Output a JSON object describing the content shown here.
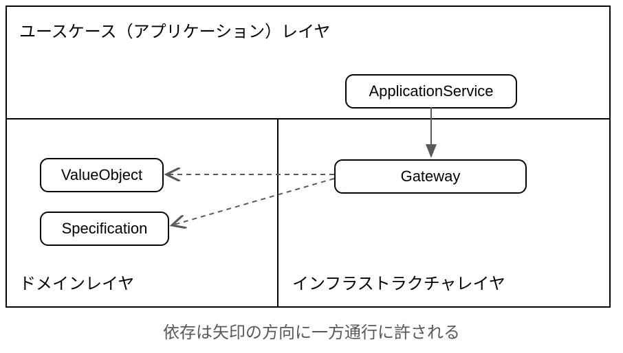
{
  "layers": {
    "usecase": {
      "title": "ユースケース（アプリケーション）レイヤ"
    },
    "domain": {
      "title": "ドメインレイヤ"
    },
    "infrastructure": {
      "title": "インフラストラクチャレイヤ"
    }
  },
  "nodes": {
    "applicationService": "ApplicationService",
    "gateway": "Gateway",
    "valueObject": "ValueObject",
    "specification": "Specification"
  },
  "caption": "依存は矢印の方向に一方通行に許される",
  "arrows": [
    {
      "from": "ApplicationService",
      "to": "Gateway",
      "style": "solid"
    },
    {
      "from": "Gateway",
      "to": "ValueObject",
      "style": "dashed"
    },
    {
      "from": "Gateway",
      "to": "Specification",
      "style": "dashed"
    }
  ],
  "colors": {
    "border": "#000000",
    "caption": "#595959",
    "arrow": "#595959"
  }
}
